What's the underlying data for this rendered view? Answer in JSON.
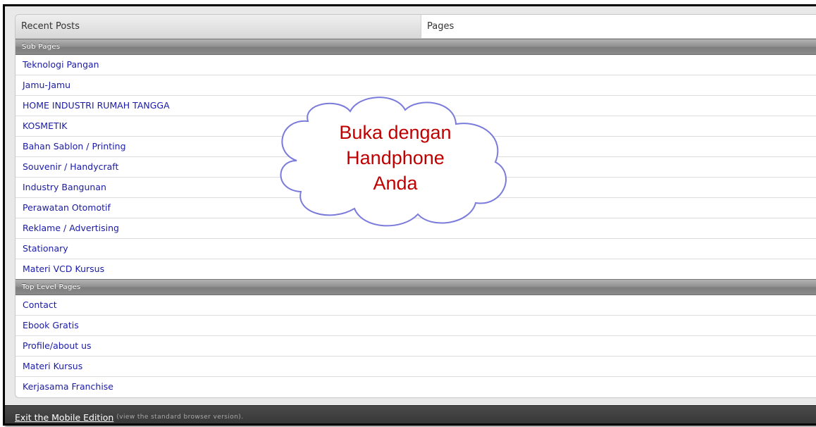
{
  "tabs": {
    "recent": "Recent Posts",
    "pages": "Pages"
  },
  "sections": {
    "sub_pages": {
      "header": "Sub Pages",
      "items": [
        "Teknologi Pangan",
        "Jamu-Jamu",
        "HOME INDUSTRI RUMAH TANGGA",
        "KOSMETIK",
        "Bahan Sablon / Printing",
        "Souvenir / Handycraft",
        "Industry Bangunan",
        "Perawatan Otomotif",
        "Reklame / Advertising",
        "Stationary",
        "Materi VCD Kursus"
      ]
    },
    "top_level": {
      "header": "Top Level Pages",
      "items": [
        "Contact",
        "Ebook Gratis",
        "Profile/about us",
        "Materi Kursus",
        "Kerjasama Franchise"
      ]
    }
  },
  "callout": {
    "lines": [
      "Buka dengan",
      "Handphone",
      "Anda"
    ]
  },
  "footer": {
    "exit_link": "Exit the Mobile Edition",
    "note": "(view the standard browser version)."
  },
  "colors": {
    "link": "#1a1aa6",
    "callout_text": "#c00000",
    "cloud_outline": "#7b7bdc",
    "footer_bg": "#3c3c3c"
  }
}
